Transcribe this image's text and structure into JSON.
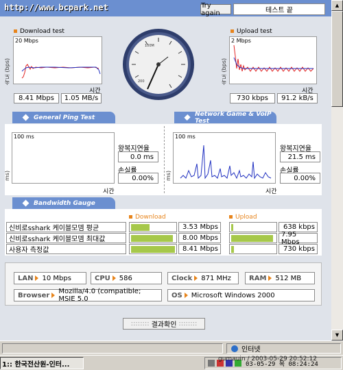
{
  "header": {
    "site_url": "http://www.bcpark.net",
    "try_again": "Try again",
    "status": "테스트 끝"
  },
  "download_test": {
    "title": "Download test",
    "axis_label": "속도 (bps)",
    "scale": "20 Mbps",
    "time_label": "시간",
    "mbps": "8.41 Mbps",
    "mbs": "1.05 MB/s"
  },
  "upload_test": {
    "title": "Upload test",
    "axis_label": "속도 (bps)",
    "scale": "2 Mbps",
    "time_label": "시간",
    "kbps": "730 kbps",
    "kbs": "91.2 kB/s"
  },
  "gauge": {
    "label_1": "100M",
    "label_2": "200"
  },
  "tabs": {
    "general_ping": "General Ping Test",
    "network_game": "Network Game & VoIP Test",
    "bandwidth": "Bandwidth Gauge"
  },
  "ping_general": {
    "axis_label": "ms)",
    "scale": "100 ms",
    "rtt_label": "왕복지연율",
    "rtt_value": "0.0 ms",
    "loss_label": "손실률",
    "loss_value": "0.00%",
    "time_label": "시간"
  },
  "ping_game": {
    "axis_label": "ms)",
    "scale": "100 ms",
    "rtt_label": "왕복지연율",
    "rtt_value": "21.5 ms",
    "loss_label": "손실률",
    "loss_value": "0.00%",
    "time_label": "시간"
  },
  "bandwidth": {
    "download_header": "Download",
    "upload_header": "Upload",
    "rows": [
      {
        "label": "신비로sshark 케이블모뎀 평균",
        "down": "3.53 Mbps",
        "down_fill": 0.42,
        "up": "638 kbps",
        "up_fill": 0.05
      },
      {
        "label": "신비로sshark 케이블모뎀 최대값",
        "down": "8.00 Mbps",
        "down_fill": 0.95,
        "up": "7.95 Mbps",
        "up_fill": 0.95
      },
      {
        "label": "사용자 측정값",
        "down": "8.41 Mbps",
        "down_fill": 1.0,
        "up": "730 kbps",
        "up_fill": 0.06
      }
    ]
  },
  "sysinfo": {
    "lan_label": "LAN",
    "lan_value": "10 Mbps",
    "cpu_label": "CPU",
    "cpu_value": "586",
    "clock_label": "Clock",
    "clock_value": "871 MHz",
    "ram_label": "RAM",
    "ram_value": "512 MB",
    "browser_label": "Browser",
    "browser_value": "Mozilla/4.0 (compatible; MSIE 5.0",
    "os_label": "OS",
    "os_value": "Microsoft Windows 2000"
  },
  "confirm_button": "결과확인",
  "statusbar": {
    "zone": "인터넷"
  },
  "taskbar": {
    "window_title": "1:: 한국전산원-인터...",
    "watermark": "gumauin / 2003-05-29 20:52:12",
    "clock": "03-05-29 목 08:24:24"
  },
  "colors": {
    "accent_blue": "#6b8fd0",
    "orange": "#e7841b",
    "bar_green": "#a6c84a",
    "graph_red": "#e02020",
    "graph_blue": "#2030c0"
  }
}
